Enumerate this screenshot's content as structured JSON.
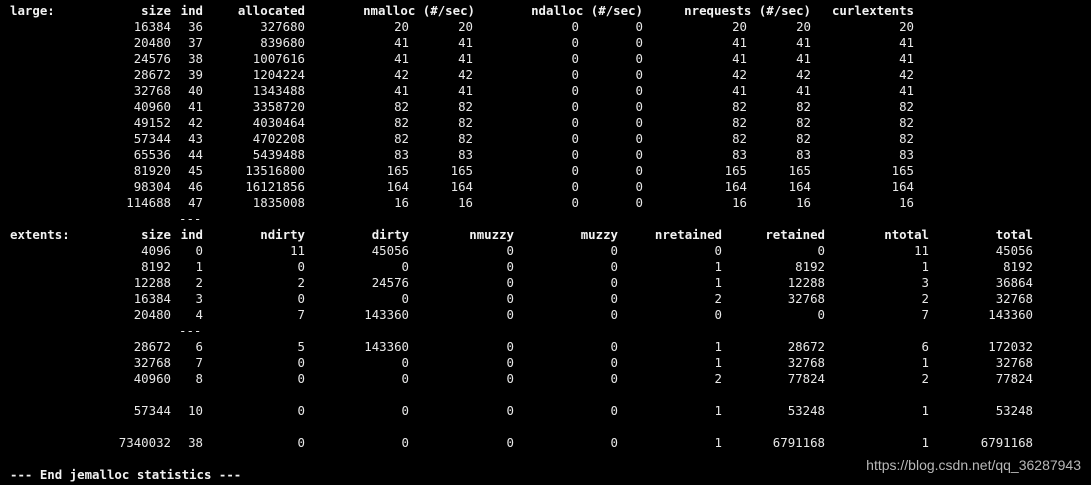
{
  "large": {
    "label": "large:",
    "headers": [
      "size",
      "ind",
      "allocated",
      "nmalloc (#/sec)",
      "ndalloc (#/sec)",
      "nrequests (#/sec)",
      "curlextents"
    ],
    "rows": [
      [
        "16384",
        "36",
        "327680",
        "20",
        "20",
        "0",
        "0",
        "20",
        "20",
        "20"
      ],
      [
        "20480",
        "37",
        "839680",
        "41",
        "41",
        "0",
        "0",
        "41",
        "41",
        "41"
      ],
      [
        "24576",
        "38",
        "1007616",
        "41",
        "41",
        "0",
        "0",
        "41",
        "41",
        "41"
      ],
      [
        "28672",
        "39",
        "1204224",
        "42",
        "42",
        "0",
        "0",
        "42",
        "42",
        "42"
      ],
      [
        "32768",
        "40",
        "1343488",
        "41",
        "41",
        "0",
        "0",
        "41",
        "41",
        "41"
      ],
      [
        "40960",
        "41",
        "3358720",
        "82",
        "82",
        "0",
        "0",
        "82",
        "82",
        "82"
      ],
      [
        "49152",
        "42",
        "4030464",
        "82",
        "82",
        "0",
        "0",
        "82",
        "82",
        "82"
      ],
      [
        "57344",
        "43",
        "4702208",
        "82",
        "82",
        "0",
        "0",
        "82",
        "82",
        "82"
      ],
      [
        "65536",
        "44",
        "5439488",
        "83",
        "83",
        "0",
        "0",
        "83",
        "83",
        "83"
      ],
      [
        "81920",
        "45",
        "13516800",
        "165",
        "165",
        "0",
        "0",
        "165",
        "165",
        "165"
      ],
      [
        "98304",
        "46",
        "16121856",
        "164",
        "164",
        "0",
        "0",
        "164",
        "164",
        "164"
      ],
      [
        "114688",
        "47",
        "1835008",
        "16",
        "16",
        "0",
        "0",
        "16",
        "16",
        "16"
      ]
    ],
    "ellipsis": "---"
  },
  "extents": {
    "label": "extents:",
    "headers": [
      "size",
      "ind",
      "ndirty",
      "dirty",
      "nmuzzy",
      "muzzy",
      "nretained",
      "retained",
      "ntotal",
      "total"
    ],
    "rows": [
      [
        "4096",
        "0",
        "11",
        "45056",
        "0",
        "0",
        "0",
        "0",
        "11",
        "45056"
      ],
      [
        "8192",
        "1",
        "0",
        "0",
        "0",
        "0",
        "1",
        "8192",
        "1",
        "8192"
      ],
      [
        "12288",
        "2",
        "2",
        "24576",
        "0",
        "0",
        "1",
        "12288",
        "3",
        "36864"
      ],
      [
        "16384",
        "3",
        "0",
        "0",
        "0",
        "0",
        "2",
        "32768",
        "2",
        "32768"
      ],
      [
        "20480",
        "4",
        "7",
        "143360",
        "0",
        "0",
        "0",
        "0",
        "7",
        "143360"
      ],
      [
        "28672",
        "6",
        "5",
        "143360",
        "0",
        "0",
        "1",
        "28672",
        "6",
        "172032"
      ],
      [
        "32768",
        "7",
        "0",
        "0",
        "0",
        "0",
        "1",
        "32768",
        "1",
        "32768"
      ],
      [
        "40960",
        "8",
        "0",
        "0",
        "0",
        "0",
        "2",
        "77824",
        "2",
        "77824"
      ],
      [
        "57344",
        "10",
        "0",
        "0",
        "0",
        "0",
        "1",
        "53248",
        "1",
        "53248"
      ],
      [
        "7340032",
        "38",
        "0",
        "0",
        "0",
        "0",
        "1",
        "6791168",
        "1",
        "6791168"
      ]
    ],
    "ellipsis": "---"
  },
  "footer": "--- End jemalloc statistics ---",
  "watermark": "https://blog.csdn.net/qq_36287943"
}
